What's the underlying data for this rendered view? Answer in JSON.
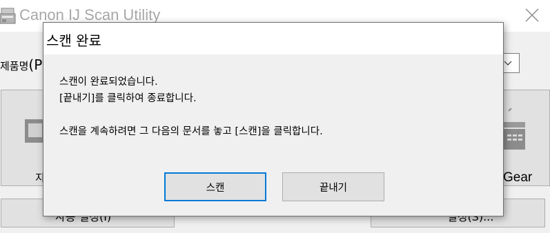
{
  "app": {
    "title": "Canon IJ Scan Utility",
    "icon": "scanner-icon",
    "close_icon": "close-icon",
    "product_label": "제품명",
    "product_value_partial": "(P",
    "dropdown_icon": "chevron-down-icon",
    "tile_left_label": "지",
    "tile_right_label": "Gear",
    "bottom_left_label": "사용 설정(I)",
    "bottom_right_label": "설정(S)..."
  },
  "dialog": {
    "title": "스캔 완료",
    "messages": [
      "스캔이 완료되었습니다.",
      "[끝내기]를 클릭하여 종료합니다.",
      "스캔을 계속하려면 그 다음의 문서를 놓고 [스캔]을 클릭합니다."
    ],
    "buttons": {
      "scan": "스캔",
      "finish": "끝내기"
    }
  },
  "colors": {
    "focus_border": "#0078d7",
    "button_face": "#e1e1e1",
    "dialog_bg": "#f0f0f0",
    "disabled_title": "#a8a8a8"
  }
}
